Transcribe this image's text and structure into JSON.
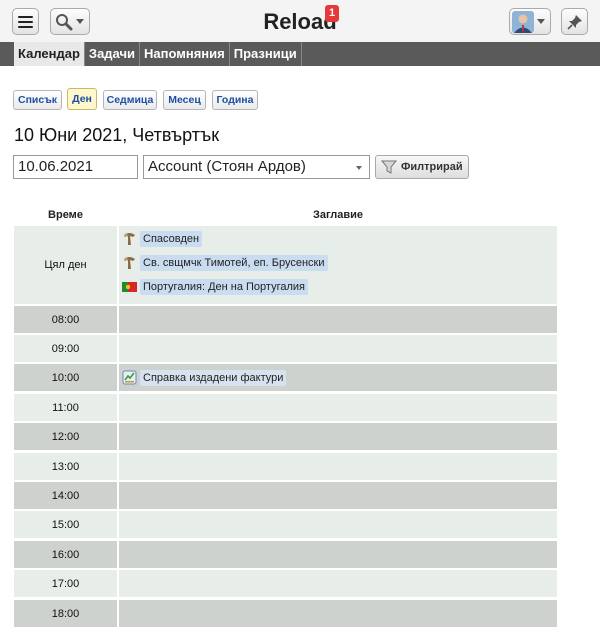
{
  "header": {
    "title": "Reload",
    "notification_count": "1",
    "icons": [
      "menu-icon",
      "search-icon",
      "user-avatar",
      "pin-icon"
    ]
  },
  "tabs": [
    {
      "label": "Календар",
      "active": true
    },
    {
      "label": "Задачи",
      "active": false
    },
    {
      "label": "Напомняния",
      "active": false
    },
    {
      "label": "Празници",
      "active": false
    }
  ],
  "views": [
    {
      "label": "Списък",
      "active": false
    },
    {
      "label": "Ден",
      "active": true
    },
    {
      "label": "Седмица",
      "active": false
    },
    {
      "label": "Месец",
      "active": false
    },
    {
      "label": "Година",
      "active": false
    }
  ],
  "date_heading": "10 Юни 2021, Четвъртък",
  "filter": {
    "date_value": "10.06.2021",
    "account_value": "Account (Стоян Ардов)",
    "button_label": "Филтрирай"
  },
  "table": {
    "headers": {
      "time": "Време",
      "title": "Заглавие"
    },
    "all_day_label": "Цял ден",
    "all_day_events": [
      {
        "label": "Спасовден",
        "icon": "holiday-icon"
      },
      {
        "label": "Св. свщмчк Тимотей, еп. Брусенски",
        "icon": "holiday-icon"
      },
      {
        "label": "Португалия: Ден на Португалия",
        "icon": "portugal-flag-icon"
      }
    ],
    "hours": [
      {
        "time": "08:00",
        "event": ""
      },
      {
        "time": "09:00",
        "event": ""
      },
      {
        "time": "10:00",
        "event": "Справка издадени фактури"
      },
      {
        "time": "11:00",
        "event": ""
      },
      {
        "time": "12:00",
        "event": ""
      },
      {
        "time": "13:00",
        "event": ""
      },
      {
        "time": "14:00",
        "event": ""
      },
      {
        "time": "15:00",
        "event": ""
      },
      {
        "time": "16:00",
        "event": ""
      },
      {
        "time": "17:00",
        "event": ""
      },
      {
        "time": "18:00",
        "event": ""
      }
    ]
  },
  "colors": {
    "tab_bar": "#5a5a5a",
    "row_light": "#e7ede8",
    "row_dark": "#cdd2ce",
    "event_bg": "#c9dcf0",
    "link_blue": "#1e4fa0",
    "badge_red": "#e5393a"
  }
}
